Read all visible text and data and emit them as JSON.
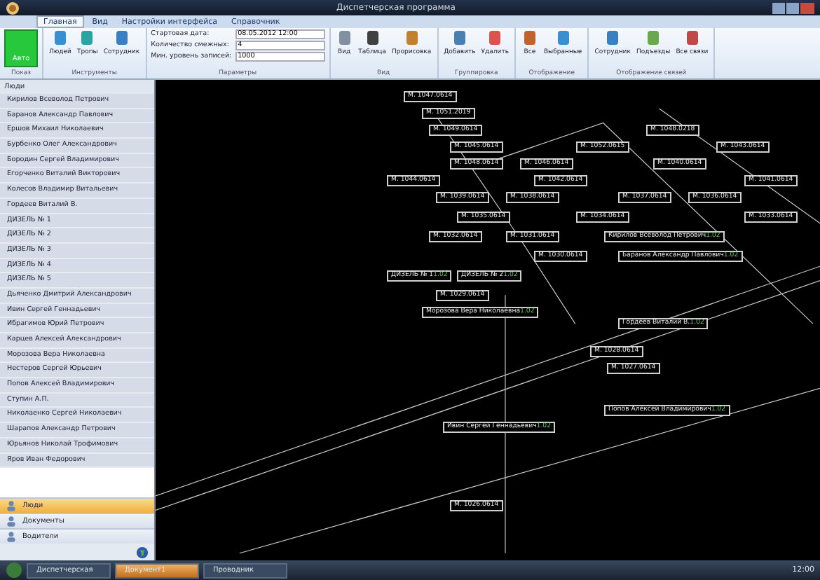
{
  "window": {
    "title": "Диспетчерская программа"
  },
  "tabs": [
    {
      "label": "Главная",
      "selected": true
    },
    {
      "label": "Вид",
      "selected": false
    },
    {
      "label": "Настройки интерфейса",
      "selected": false
    },
    {
      "label": "Справочник",
      "selected": false
    }
  ],
  "ribbon": {
    "groups": [
      {
        "label": "Показ",
        "kind": "big",
        "buttons": [
          {
            "label": "Авто"
          }
        ]
      },
      {
        "label": "Инструменты",
        "kind": "icons",
        "buttons": [
          {
            "label": "Людей"
          },
          {
            "label": "Тропы"
          },
          {
            "label": "Сотрудник"
          }
        ]
      },
      {
        "label": "Параметры",
        "kind": "fields",
        "fields": [
          {
            "label": "Стартовая дата:",
            "value": "08.05.2012 12:00"
          },
          {
            "label": "Количество смежных:",
            "value": "4"
          },
          {
            "label": "Мин. уровень записей:",
            "value": "1000"
          }
        ]
      },
      {
        "label": "Вид",
        "kind": "icons",
        "buttons": [
          {
            "label": "Вид"
          },
          {
            "label": "Таблица"
          },
          {
            "label": "Прорисовка"
          }
        ]
      },
      {
        "label": "Группировка",
        "kind": "icons",
        "buttons": [
          {
            "label": "Добавить"
          },
          {
            "label": "Удалить"
          }
        ]
      },
      {
        "label": "Отображение",
        "kind": "icons",
        "buttons": [
          {
            "label": "Все"
          },
          {
            "label": "Выбранные"
          }
        ]
      },
      {
        "label": "Отображение связей",
        "kind": "icons",
        "buttons": [
          {
            "label": "Сотрудник"
          },
          {
            "label": "Подъезды"
          },
          {
            "label": "Все связи"
          }
        ]
      }
    ]
  },
  "sidebar": {
    "header": "Люди",
    "items": [
      "Кирилов Всеволод Петрович",
      "Баранов Александр Павлович",
      "Ершов Михаил Николаевич",
      "Бурбенко Олег Александрович",
      "Бородин Сергей Владимирович",
      "Егорченко Виталий Викторович",
      "Колесов Владимир Витальевич",
      "Гордеев Виталий В.",
      "ДИЗЕЛЬ № 1",
      "ДИЗЕЛЬ № 2",
      "ДИЗЕЛЬ № 3",
      "ДИЗЕЛЬ № 4",
      "ДИЗЕЛЬ № 5",
      "Дьяченко Дмитрий Александрович",
      "Ивин Сергей Геннадьевич",
      "Ибрагимов Юрий Петрович",
      "Карцев Алексей Александрович",
      "Морозова Вера Николаевна",
      "Нестеров Сергей Юрьевич",
      "Попов Алексей Владимирович",
      "Ступин А.П.",
      "Николаенко Сергей Николаевич",
      "Шарапов Александр Петрович",
      "Юрьянов Николай Трофимович",
      "Яров Иван Федорович"
    ],
    "nav": [
      {
        "label": "Люди",
        "selected": true
      },
      {
        "label": "Документы",
        "selected": false
      },
      {
        "label": "Водители",
        "selected": false
      }
    ]
  },
  "diagram": {
    "nodes": [
      {
        "label": "М. 1047.0614"
      },
      {
        "label": "М. 1051.2019"
      },
      {
        "label": "М. 1049.0614"
      },
      {
        "label": "М. 1048.0218"
      },
      {
        "label": "М. 1045.0614"
      },
      {
        "label": "М. 1052.0615"
      },
      {
        "label": "М. 1043.0614"
      },
      {
        "label": "М. 1048.0614"
      },
      {
        "label": "М. 1046.0614"
      },
      {
        "label": "М. 1040.0614"
      },
      {
        "label": "М. 1044.0614"
      },
      {
        "label": "М. 1042.0614"
      },
      {
        "label": "М. 1041.0614"
      },
      {
        "label": "М. 1039.0614"
      },
      {
        "label": "М. 1038.0614"
      },
      {
        "label": "М. 1037.0614"
      },
      {
        "label": "М. 1036.0614"
      },
      {
        "label": "М. 1035.0614"
      },
      {
        "label": "М. 1034.0614"
      },
      {
        "label": "М. 1033.0614"
      },
      {
        "label": "М. 1032.0614"
      },
      {
        "label": "М. 1031.0614"
      },
      {
        "label": "Кирилов Всеволод Петрович",
        "note": "1.02"
      },
      {
        "label": "М. 1030.0614"
      },
      {
        "label": "Баранов Александр Павлович",
        "note": "1.02"
      },
      {
        "label": "ДИЗЕЛЬ № 1",
        "note": "1.02"
      },
      {
        "label": "ДИЗЕЛЬ № 2",
        "note": "1.02"
      },
      {
        "label": "М. 1029.0614"
      },
      {
        "label": "Морозова Вера Николаевна",
        "note": "1.02"
      },
      {
        "label": "Гордеев Виталий В.",
        "note": "1.02"
      },
      {
        "label": "М. 1028.0614"
      },
      {
        "label": "М. 1027.0614"
      },
      {
        "label": "Попов Алексей Владимирович",
        "note": "1.02"
      },
      {
        "label": "Ивин Сергей Геннадьевич",
        "note": "1.02"
      },
      {
        "label": "М. 1026.0614"
      }
    ]
  },
  "taskbar": {
    "buttons": [
      {
        "label": "Диспетчерская",
        "selected": false
      },
      {
        "label": "Документ1",
        "selected": true
      },
      {
        "label": "Проводник",
        "selected": false
      }
    ],
    "clock": "12:00"
  }
}
